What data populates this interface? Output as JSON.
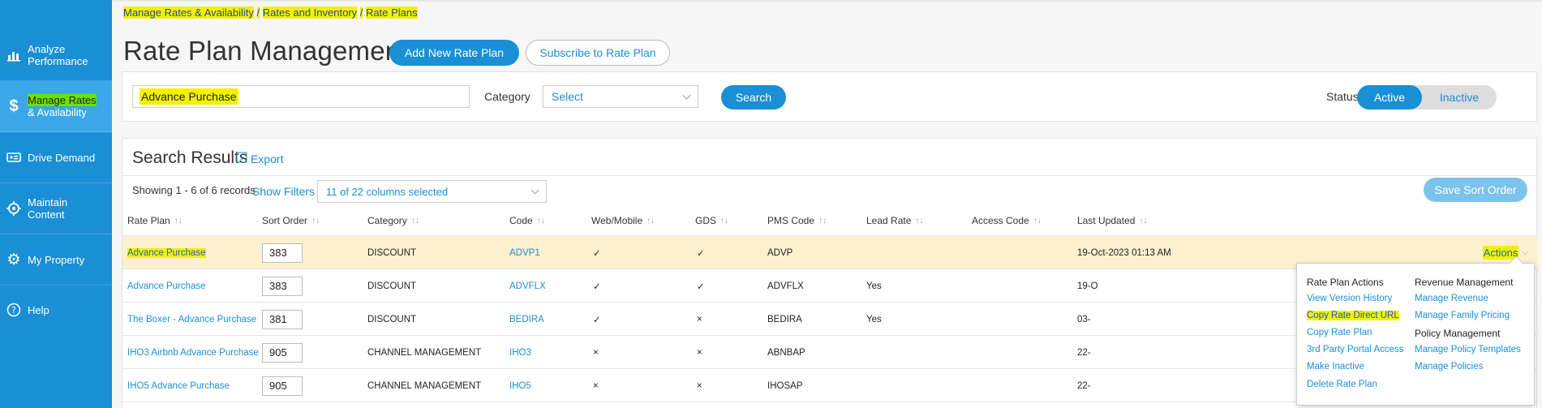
{
  "sidebar": {
    "items": [
      {
        "label1": "Analyze",
        "label2": "Performance",
        "icon": "bar-chart-icon"
      },
      {
        "label1": "Manage Rates",
        "label2": "& Availability",
        "icon": "dollar-icon"
      },
      {
        "label": "Drive Demand",
        "icon": "ticket-icon"
      },
      {
        "label1": "Maintain",
        "label2": "Content",
        "icon": "crosshair-icon"
      },
      {
        "label": "My Property",
        "icon": "gear-icon"
      },
      {
        "label": "Help",
        "icon": "help-icon"
      }
    ]
  },
  "breadcrumb": {
    "b1": "Manage Rates & Availability",
    "sep": "/",
    "b2": "Rates and Inventory",
    "b3": "Rate Plans"
  },
  "header": {
    "title": "Rate Plan Management",
    "add_button": "Add New Rate Plan",
    "subscribe_button": "Subscribe to Rate Plan"
  },
  "search": {
    "value": "Advance Purchase",
    "category_label": "Category",
    "category_value": "Select",
    "search_button": "Search",
    "status_label": "Status",
    "status_active": "Active",
    "status_inactive": "Inactive"
  },
  "results": {
    "title": "Search Results",
    "export": "Export",
    "showing": "Showing 1 - 6 of 6 records",
    "show_filters": "Show Filters",
    "columns_selected": "11 of 22 columns selected",
    "save_sort": "Save Sort Order",
    "columns": [
      "Rate Plan",
      "Sort Order",
      "Category",
      "Code",
      "Web/Mobile",
      "GDS",
      "PMS Code",
      "Lead Rate",
      "Access Code",
      "Last Updated"
    ],
    "rows": [
      {
        "name": "Advance Purchase",
        "order": "383",
        "category": "DISCOUNT",
        "code": "ADVP1",
        "web": "✓",
        "gds": "✓",
        "pms": "ADVP",
        "lead": "",
        "access": "",
        "updated": "19-Oct-2023 01:13 AM",
        "actions": "Actions"
      },
      {
        "name": "Advance Purchase",
        "order": "383",
        "category": "DISCOUNT",
        "code": "ADVFLX",
        "web": "✓",
        "gds": "✓",
        "pms": "ADVFLX",
        "lead": "Yes",
        "access": "",
        "updated": "19-O"
      },
      {
        "name": "The Boxer - Advance Purchase",
        "order": "381",
        "category": "DISCOUNT",
        "code": "BEDIRA",
        "web": "✓",
        "gds": "×",
        "pms": "BEDIRA",
        "lead": "Yes",
        "access": "",
        "updated": "03-"
      },
      {
        "name": "IHO3 Airbnb Advance Purchase",
        "order": "905",
        "category": "CHANNEL MANAGEMENT",
        "code": "IHO3",
        "web": "×",
        "gds": "×",
        "pms": "ABNBAP",
        "lead": "",
        "access": "",
        "updated": "22-"
      },
      {
        "name": "IHO5 Advance Purchase",
        "order": "905",
        "category": "CHANNEL MANAGEMENT",
        "code": "IHO5",
        "web": "×",
        "gds": "×",
        "pms": "IHOSAP",
        "lead": "",
        "access": "",
        "updated": "22-"
      }
    ]
  },
  "menu": {
    "rate_plan_actions": "Rate Plan Actions",
    "view_version_history": "View Version History",
    "copy_rate_direct_url": "Copy Rate Direct URL",
    "copy_rate_plan": "Copy Rate Plan",
    "third_party": "3rd Party Portal Access",
    "make_inactive": "Make Inactive",
    "delete_rate_plan": "Delete Rate Plan",
    "revenue_management": "Revenue Management",
    "manage_revenue": "Manage Revenue",
    "manage_family_pricing": "Manage Family Pricing",
    "policy_management": "Policy Management",
    "manage_policy_templates": "Manage Policy Templates",
    "manage_policies": "Manage Policies"
  },
  "colors": {
    "accent": "#1a8fd6",
    "highlight": "#f2f200",
    "selected_row": "#fdf0cf"
  }
}
